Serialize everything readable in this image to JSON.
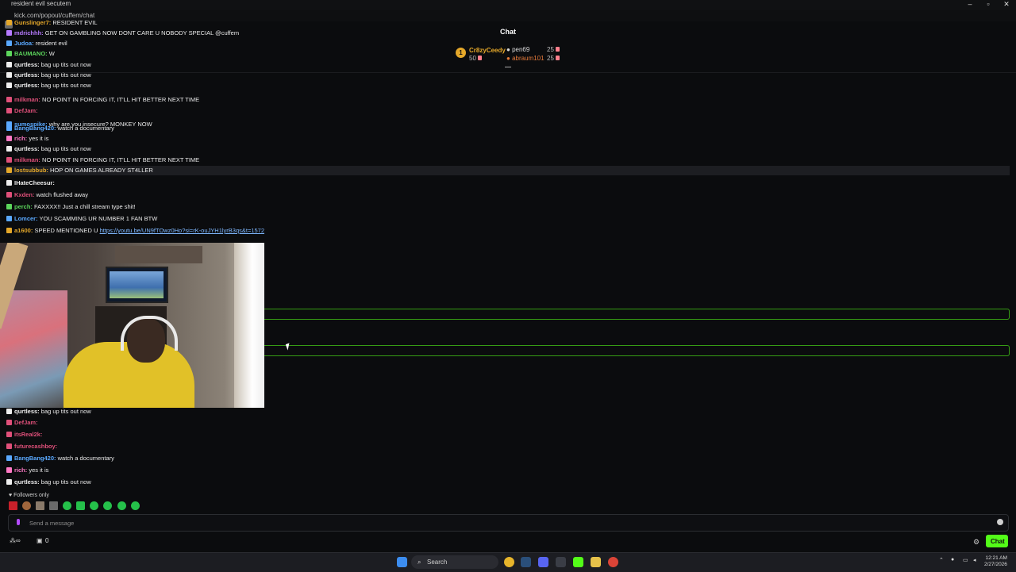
{
  "browser": {
    "tab_title": "resident evil secutem",
    "window_title": "Chat - Google Chrome",
    "url": "kick.com/popout/cuffem/chat"
  },
  "chat": {
    "title": "Chat",
    "leaderboard": [
      {
        "rank": "1",
        "name": "Cr8zyCeedy",
        "amount": "50",
        "color": "#e5a82a"
      },
      {
        "name": "pen69",
        "amount": "25",
        "color": "#dddddd"
      },
      {
        "name": "abraum101",
        "amount": "25",
        "color": "#e57a3a"
      }
    ],
    "messages_top": [
      {
        "user": "Gunslinger7:",
        "text": "RESIDENT EVIL",
        "color": "#e5a82a"
      },
      {
        "user": "mdrichhh:",
        "text": "GET ON GAMBLING NOW DONT CARE U NOBODY SPECIAL @cuffem",
        "color": "#b77bff"
      },
      {
        "user": "Judoa:",
        "text": "resident evil",
        "color": "#5aa9ff"
      },
      {
        "user": "BAUMANO:",
        "text": "W",
        "color": "#5cd65c"
      },
      {
        "user": "qurtless:",
        "text": "bag up tits out now",
        "color": "#eeeeee"
      },
      {
        "user": "qurtless:",
        "text": "bag up tits out now",
        "color": "#eeeeee"
      },
      {
        "user": "qurtless:",
        "text": "bag up tits out now",
        "color": "#eeeeee"
      },
      {
        "user": "milkman:",
        "text": "NO POINT IN FORCING IT, IT'LL HIT BETTER NEXT TIME",
        "color": "#e0507a"
      },
      {
        "user": "DefJam:",
        "text": "",
        "color": "#e0507a"
      },
      {
        "user": "sumospike:",
        "text": "why are you insecure? MONKEY NOW",
        "color": "#5aa9ff"
      },
      {
        "user": "BangBang420:",
        "text": "watch a documentary",
        "color": "#5aa9ff"
      },
      {
        "user": "rich:",
        "text": "yes it is",
        "color": "#ff79c6"
      },
      {
        "user": "qurtless:",
        "text": "bag up tits out now",
        "color": "#eeeeee"
      },
      {
        "user": "milkman:",
        "text": "NO POINT IN FORCING IT, IT'LL HIT BETTER NEXT TIME",
        "color": "#e0507a"
      },
      {
        "user": "lostsubbub:",
        "text": "HOP ON GAMES ALREADY ST4LLER",
        "color": "#e5a82a"
      },
      {
        "user": "IHateCheesur:",
        "text": "",
        "color": "#eeeeee"
      },
      {
        "user": "Kxden:",
        "text": "watch flushed away",
        "color": "#e0507a"
      },
      {
        "user": "perch:",
        "text": "FAXXXX!! Just a chill stream type shit!",
        "color": "#5cd65c"
      },
      {
        "user": "Lomcer:",
        "text": "YOU SCAMMING UR NUMBER 1 FAN BTW",
        "color": "#5aa9ff"
      },
      {
        "user": "a1600:",
        "text": "SPEED MENTIONED U",
        "link": "https://youtu.be/UN9fTOwz0Ho?si=rK-ouJYH1lyrB3qs&t=1572",
        "color": "#e5a82a"
      }
    ],
    "messages_bottom": [
      {
        "user": "qurtless:",
        "text": "bag up tits out now",
        "color": "#eeeeee"
      },
      {
        "user": "DefJam:",
        "text": "",
        "color": "#e0507a"
      },
      {
        "user": "itsReal2k:",
        "text": "",
        "color": "#e0507a"
      },
      {
        "user": "futurecashboy:",
        "text": "",
        "color": "#e0507a"
      },
      {
        "user": "BangBang420:",
        "text": "watch a documentary",
        "color": "#5aa9ff"
      },
      {
        "user": "rich:",
        "text": "yes it is",
        "color": "#ff79c6"
      },
      {
        "user": "qurtless:",
        "text": "bag up tits out now",
        "color": "#eeeeee"
      }
    ],
    "followers_only": "Followers only",
    "input_placeholder": "Send a message",
    "bottom_left_count": "0",
    "chat_button": "Chat",
    "accent_color": "#53fc18"
  },
  "taskbar": {
    "search_label": "Search",
    "time": "12:21 AM",
    "date": "2/27/2026"
  }
}
